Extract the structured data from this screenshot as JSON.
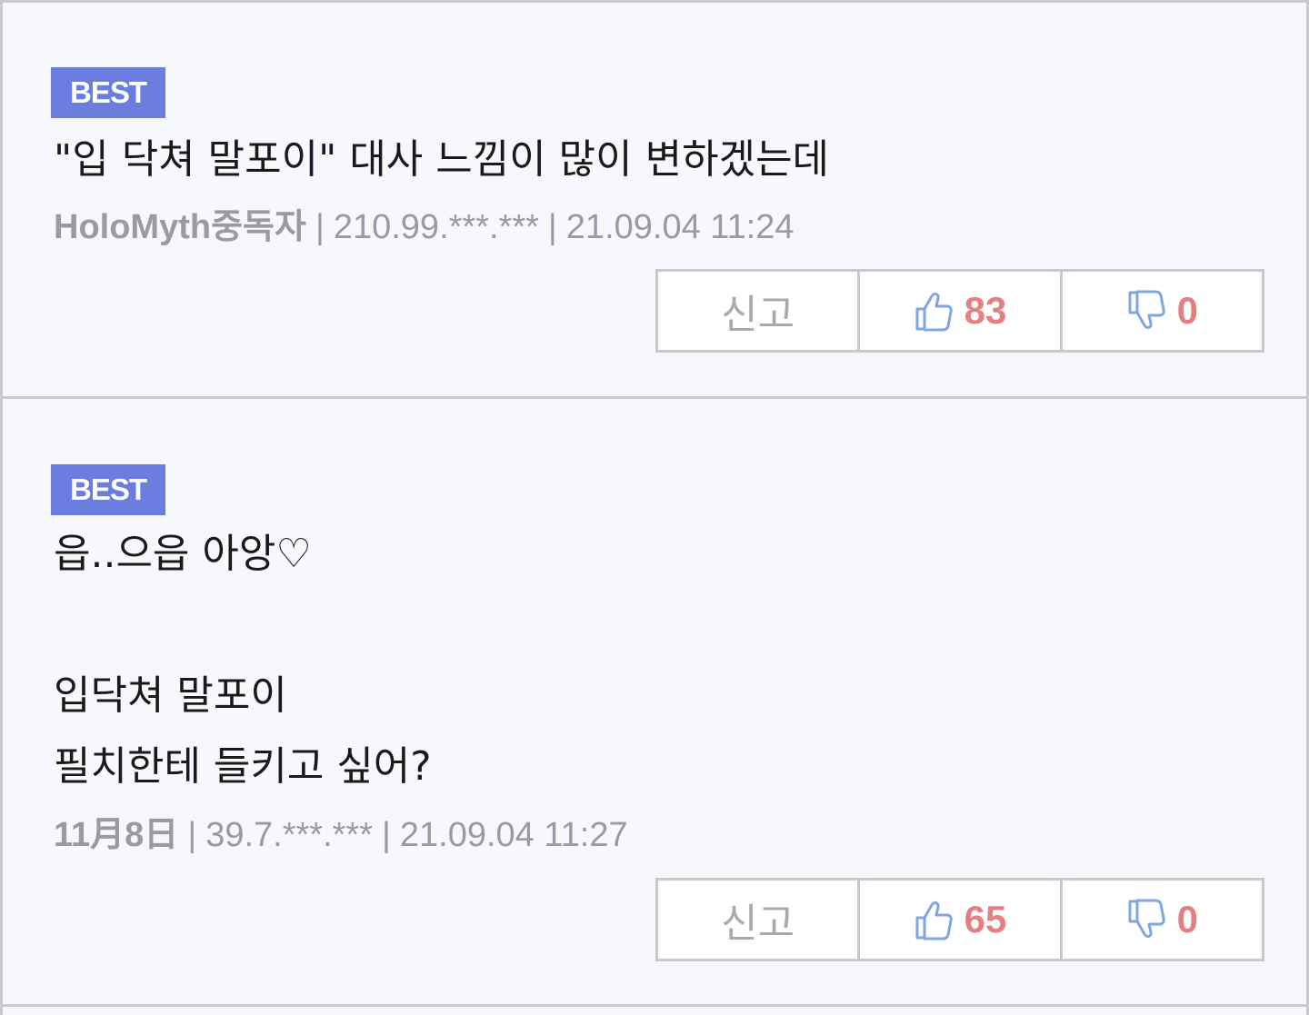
{
  "comments": [
    {
      "badge": "BEST",
      "body": "\"입 닥쳐 말포이\" 대사 느낌이 많이 변하겠는데",
      "author": "HoloMyth중독자",
      "ip": "210.99.***.***",
      "datetime": "21.09.04 11:24",
      "report_label": "신고",
      "likes": "83",
      "dislikes": "0"
    },
    {
      "badge": "BEST",
      "body_lines": [
        "읍..으읍 아앙♡",
        "",
        "입닥쳐 말포이",
        "필치한테 들키고 싶어?"
      ],
      "author": "11月8日",
      "ip": "39.7.***.***",
      "datetime": "21.09.04 11:27",
      "report_label": "신고",
      "likes": "65",
      "dislikes": "0"
    }
  ],
  "separator": "|",
  "colors": {
    "badge_bg": "#6b7ddf",
    "vote_count": "#e57f82",
    "thumb_icon": "#7fa6e0",
    "meta_text": "#9a9aa3",
    "border": "#c8c9cd",
    "panel_bg": "#f7f8fc"
  },
  "icons": {
    "like": "thumbs-up-icon",
    "dislike": "thumbs-down-icon"
  }
}
